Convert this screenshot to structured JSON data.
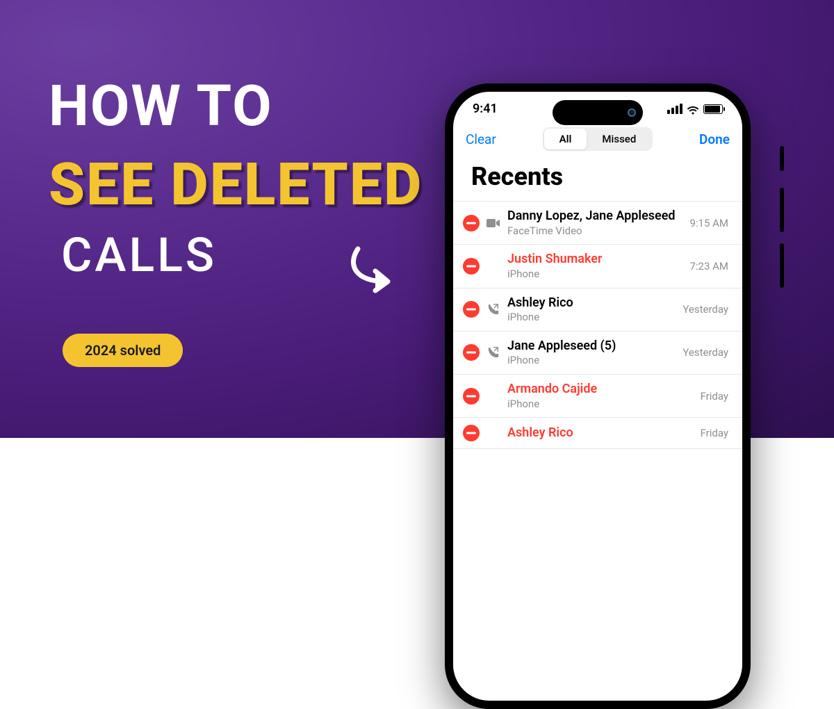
{
  "headline": {
    "line1": "HOW TO",
    "line2": "SEE DELETED",
    "line3": "CALLS"
  },
  "badge": "2024 solved",
  "phone": {
    "status_time": "9:41",
    "nav": {
      "clear": "Clear",
      "done": "Done",
      "seg_all": "All",
      "seg_missed": "Missed"
    },
    "page_title": "Recents",
    "rows": [
      {
        "name": "Danny Lopez, Jane Appleseed",
        "sub": "FaceTime Video",
        "time": "9:15 AM",
        "missed": false,
        "icon": "video"
      },
      {
        "name": "Justin Shumaker",
        "sub": "iPhone",
        "time": "7:23 AM",
        "missed": true,
        "icon": "none"
      },
      {
        "name": "Ashley Rico",
        "sub": "iPhone",
        "time": "Yesterday",
        "missed": false,
        "icon": "phone"
      },
      {
        "name": "Jane Appleseed (5)",
        "sub": "iPhone",
        "time": "Yesterday",
        "missed": false,
        "icon": "phone"
      },
      {
        "name": "Armando Cajide",
        "sub": "iPhone",
        "time": "Friday",
        "missed": true,
        "icon": "none"
      },
      {
        "name": "Ashley Rico",
        "sub": "",
        "time": "Friday",
        "missed": true,
        "icon": "none"
      }
    ]
  }
}
